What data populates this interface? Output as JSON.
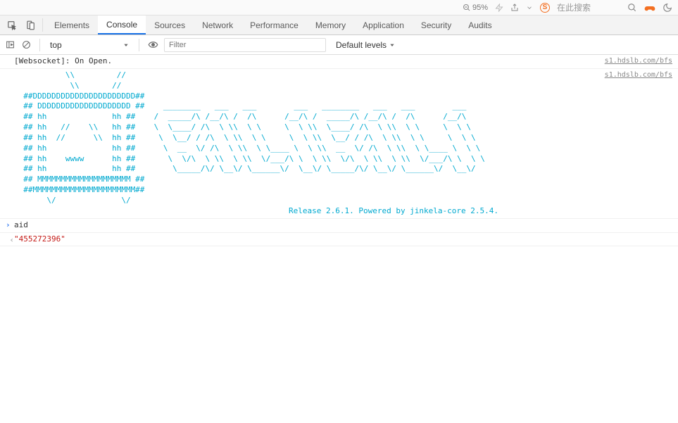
{
  "browser": {
    "zoom_label": "95%",
    "search_placeholder": "在此搜索"
  },
  "tabs": {
    "elements": "Elements",
    "console": "Console",
    "sources": "Sources",
    "network": "Network",
    "performance": "Performance",
    "memory": "Memory",
    "application": "Application",
    "security": "Security",
    "audits": "Audits"
  },
  "toolbar": {
    "context": "top",
    "filter_placeholder": "Filter",
    "levels_label": "Default levels"
  },
  "logs": {
    "websocket_msg": "[Websocket]: On Open.",
    "src1": "s1.hdslb.com/bfs",
    "src2": "s1.hdslb.com/bfs",
    "ascii_art": "           \\\\         //\n            \\\\       //\n  ##DDDDDDDDDDDDDDDDDDDDDD##\n  ## DDDDDDDDDDDDDDDDDDDD ##    ________   ___   ___        ___   ________   ___   ___        ___\n  ## hh              hh ##    /  _____/\\ /__/\\ /  /\\      /__/\\ /  _____/\\ /__/\\ /  /\\      /__/\\\n  ## hh   //    \\\\   hh ##    \\  \\____/ /\\  \\ \\\\  \\ \\     \\  \\ \\\\  \\____/ /\\  \\ \\\\  \\ \\     \\  \\ \\\n  ## hh  //      \\\\  hh ##     \\  \\__/ / /\\  \\ \\\\  \\ \\     \\  \\ \\\\  \\__/ / /\\  \\ \\\\  \\ \\     \\  \\ \\\n  ## hh              hh ##      \\  __  \\/ /\\  \\ \\\\  \\ \\____ \\  \\ \\\\  __  \\/ /\\  \\ \\\\  \\ \\____ \\  \\ \\\n  ## hh    wwww      hh ##       \\  \\/\\  \\ \\\\  \\ \\\\  \\/___/\\ \\  \\ \\\\  \\/\\  \\ \\\\  \\ \\\\  \\/___/\\ \\  \\ \\\n  ## hh              hh ##        \\_____/\\/ \\__\\/ \\______\\/  \\__\\/ \\_____/\\/ \\__\\/ \\______\\/  \\__\\/\n  ## MMMMMMMMMMMMMMMMMMMM ##\n  ##MMMMMMMMMMMMMMMMMMMMMM##\n       \\/              \\/",
    "release_line": "Release 2.6.1. Powered by jinkela-core 2.5.4."
  },
  "repl": {
    "input": "aid",
    "output": "\"455272396\""
  }
}
